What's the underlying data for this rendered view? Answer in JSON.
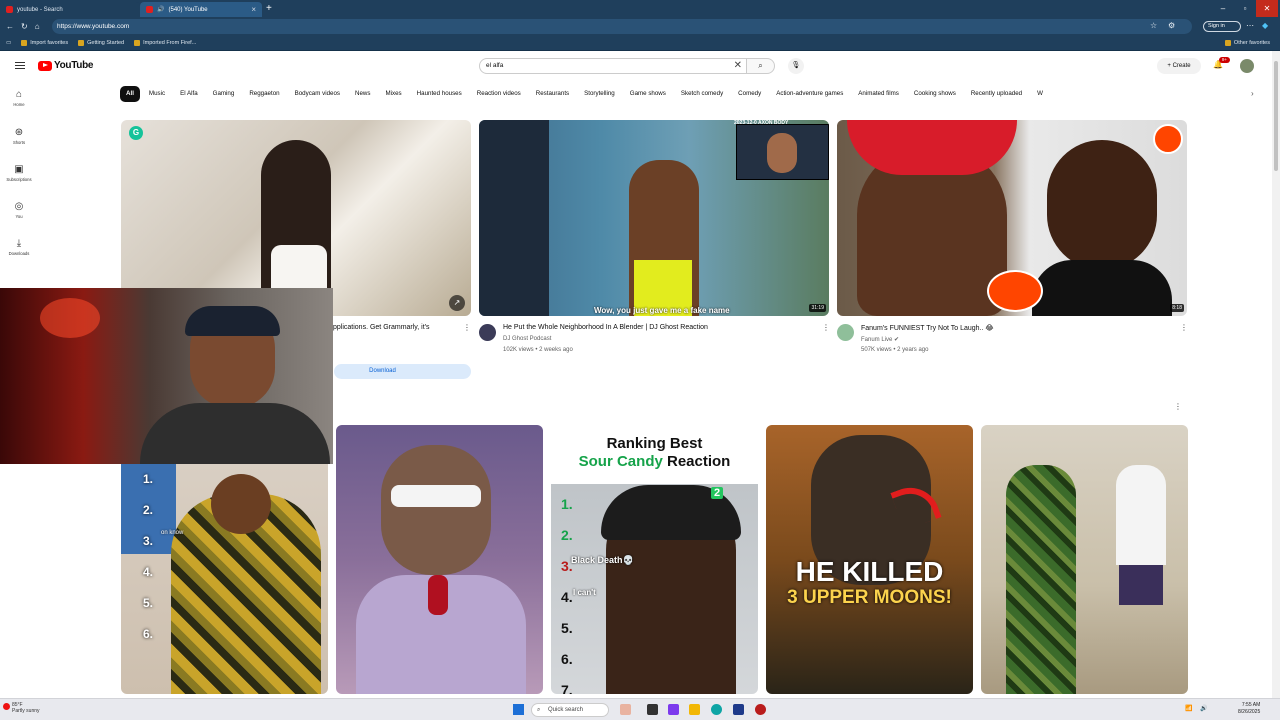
{
  "browser": {
    "tabs": [
      {
        "label": "youtube - Search",
        "active": false
      },
      {
        "label": "(540) YouTube",
        "active": true
      }
    ],
    "url": "https://www.youtube.com",
    "signin_label": "Sign in",
    "bookmarks": [
      "Import favorites",
      "Getting Started",
      "Imported From Firef..."
    ],
    "other_favorites": "Other favorites"
  },
  "header": {
    "logo": "YouTube",
    "search_value": "el alfa",
    "create_label": "Create",
    "notification_count": "9+"
  },
  "sidebar": {
    "items": [
      {
        "label": "Home",
        "icon": "home-icon"
      },
      {
        "label": "Shorts",
        "icon": "shorts-icon"
      },
      {
        "label": "Subscriptions",
        "icon": "subscriptions-icon"
      },
      {
        "label": "You",
        "icon": "you-icon"
      },
      {
        "label": "Downloads",
        "icon": "downloads-icon"
      }
    ]
  },
  "chips": [
    "All",
    "Music",
    "El Alfa",
    "Gaming",
    "Reggaeton",
    "Bodycam videos",
    "News",
    "Mixes",
    "Haunted houses",
    "Reaction videos",
    "Restaurants",
    "Storytelling",
    "Game shows",
    "Sketch comedy",
    "Comedy",
    "Action-adventure games",
    "Animated films",
    "Cooking shows",
    "Recently uploaded",
    "W"
  ],
  "videos": [
    {
      "title": "pplications. Get Grammarly, it's",
      "cta": "Download"
    },
    {
      "title": "He Put the Whole Neighborhood In A Blender | DJ Ghost Reaction",
      "channel": "DJ Ghost Podcast",
      "meta": "102K views • 2 weeks ago",
      "duration": "31:19",
      "caption": "Wow, you just gave me a fake name",
      "overlay": "2023-12-0  AXON BODY"
    },
    {
      "title": "Fanum's FUNNIEST Try Not To Laugh.. 😂",
      "channel": "Fanum Live",
      "meta": "507K views • 2 years ago",
      "duration": "8:18"
    }
  ],
  "shorts": [
    {
      "overlay_lines": [
        "1.",
        "2.",
        "3.",
        "4.",
        "5.",
        "6."
      ],
      "overlay_extra": "on know"
    },
    {
      "overlay_lines": []
    },
    {
      "heading_1": "Ranking Best",
      "heading_2": "Sour Candy",
      "heading_3": "Reaction",
      "overlay_lines": [
        "1.",
        "2.",
        "3.",
        "4.",
        "5.",
        "6.",
        "7."
      ],
      "labels": [
        "Black Death💀",
        "I can't"
      ],
      "badge": "2"
    },
    {
      "overlay_1": "HE KILLED",
      "overlay_2": "3 UPPER MOONS!"
    },
    {
      "overlay_lines": []
    }
  ],
  "taskbar": {
    "weather_temp": "85°F",
    "weather_desc": "Partly sunny",
    "search_placeholder": "Quick search",
    "time": "7:55 AM",
    "date": "8/26/2025"
  }
}
